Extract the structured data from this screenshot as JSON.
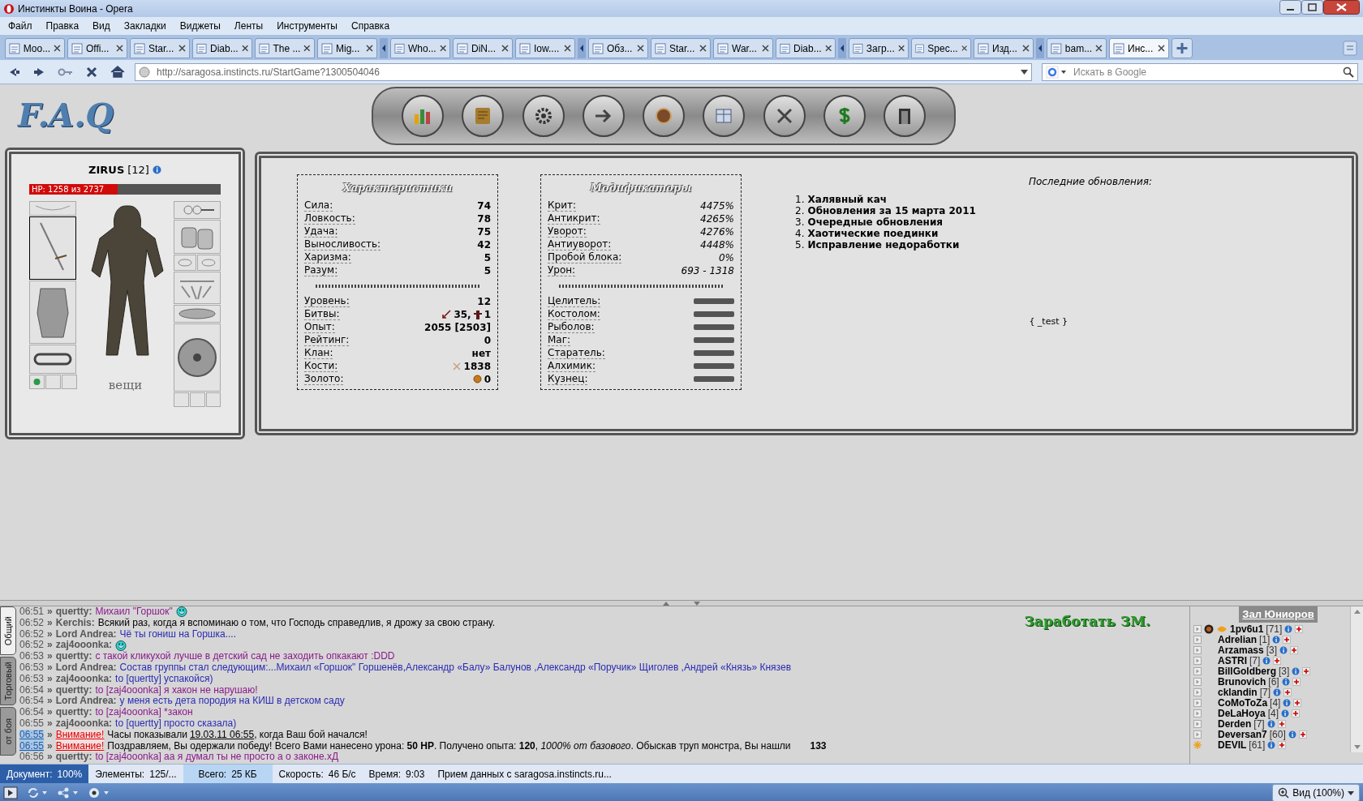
{
  "window": {
    "title": "Инстинкты Воина - Opera"
  },
  "menu": [
    "Файл",
    "Правка",
    "Вид",
    "Закладки",
    "Виджеты",
    "Ленты",
    "Инструменты",
    "Справка"
  ],
  "tabs": [
    {
      "kind": "tab",
      "label": "Moo...",
      "selected": false
    },
    {
      "kind": "tab",
      "label": "Offi...",
      "selected": false
    },
    {
      "kind": "tab",
      "label": "Star...",
      "selected": false
    },
    {
      "kind": "tab",
      "label": "Diab...",
      "selected": false
    },
    {
      "kind": "tab",
      "label": "The ...",
      "selected": false
    },
    {
      "kind": "tab",
      "label": "Mig...",
      "selected": false
    },
    {
      "kind": "stack"
    },
    {
      "kind": "tab",
      "label": "Who...",
      "selected": false
    },
    {
      "kind": "tab",
      "label": "DiN...",
      "selected": false
    },
    {
      "kind": "tab",
      "label": "Iow....",
      "selected": false
    },
    {
      "kind": "stack"
    },
    {
      "kind": "tab",
      "label": "Обз...",
      "selected": false
    },
    {
      "kind": "tab",
      "label": "Star...",
      "selected": false
    },
    {
      "kind": "tab",
      "label": "War...",
      "selected": false
    },
    {
      "kind": "tab",
      "label": "Diab...",
      "selected": false
    },
    {
      "kind": "stack"
    },
    {
      "kind": "tab",
      "label": "Загр...",
      "selected": false
    },
    {
      "kind": "tab",
      "label": "Spec...",
      "selected": false
    },
    {
      "kind": "tab",
      "label": "Изд...",
      "selected": false
    },
    {
      "kind": "stack"
    },
    {
      "kind": "tab",
      "label": "bam...",
      "selected": false
    },
    {
      "kind": "tab",
      "label": "Инс...",
      "selected": true
    }
  ],
  "address": {
    "url": "http://saragosa.instincts.ru/StartGame?1300504046"
  },
  "search": {
    "placeholder": "Искать в Google"
  },
  "logo": "F.A.Q",
  "character": {
    "name": "ZIRUS",
    "level": "[12]",
    "hp": {
      "text": "HP: 1258 из 2737",
      "level": 0.46
    },
    "items_label": "вещи"
  },
  "stats": {
    "title": "Характеристики",
    "rows": [
      {
        "label": "Сила:",
        "value": "74"
      },
      {
        "label": "Ловкость:",
        "value": "78"
      },
      {
        "label": "Удача:",
        "value": "75"
      },
      {
        "label": "Выносливость:",
        "value": "42"
      },
      {
        "label": "Харизма:",
        "value": "5"
      },
      {
        "label": "Разум:",
        "value": "5"
      }
    ],
    "rows2": [
      {
        "kind": "plain",
        "label": "Уровень:",
        "value": "12"
      },
      {
        "kind": "battles",
        "label": "Битвы:",
        "wins": "35,",
        "losses": "1"
      },
      {
        "kind": "plain",
        "label": "Опыт:",
        "value": "2055 [2503]"
      },
      {
        "kind": "plain",
        "label": "Рейтинг:",
        "value": "0"
      },
      {
        "kind": "plain",
        "label": "Клан:",
        "value": "нет"
      },
      {
        "kind": "bones",
        "label": "Кости:",
        "value": "1838"
      },
      {
        "kind": "gold",
        "label": "Золото:",
        "value": "0"
      }
    ]
  },
  "modifiers": {
    "title": "Модификаторы",
    "rows": [
      {
        "label": "Крит:",
        "value": "4475%"
      },
      {
        "label": "Антикрит:",
        "value": "4265%"
      },
      {
        "label": "Уворот:",
        "value": "4276%"
      },
      {
        "label": "Антиуворот:",
        "value": "4448%"
      },
      {
        "label": "Пробой блока:",
        "value": "0%"
      },
      {
        "label": "Урон:",
        "value": "693 - 1318"
      }
    ],
    "skills": [
      {
        "label": "Целитель:",
        "level": 0
      },
      {
        "label": "Костолом:",
        "level": 0
      },
      {
        "label": "Рыболов:",
        "level": 0
      },
      {
        "label": "Маг:",
        "level": 0
      },
      {
        "label": "Старатель:",
        "level": 0
      },
      {
        "label": "Алхимик:",
        "level": 0
      },
      {
        "label": "Кузнец:",
        "level": 0
      }
    ]
  },
  "updates": {
    "title": "Последние обновления:",
    "items": [
      {
        "number": "1.",
        "title": "Халявный кач"
      },
      {
        "number": "2.",
        "title": "Обновления за 15 марта 2011"
      },
      {
        "number": "3.",
        "title": "Очередные обновления"
      },
      {
        "number": "4.",
        "title": "Хаотические поединки"
      },
      {
        "number": "5.",
        "title": "Исправление недоработки"
      }
    ]
  },
  "test_label": "{ _test }",
  "chat": {
    "tabs": [
      {
        "label": "Общий",
        "selected": true
      },
      {
        "label": "Торговый",
        "selected": false
      },
      {
        "label": "от боя",
        "selected": false
      }
    ],
    "lines": [
      {
        "kind": "message",
        "time": "06:51",
        "marker": "»",
        "author": "quertty:",
        "text": "Михаил \"Горшок\"",
        "color": "#8b1a8b",
        "smiley": true
      },
      {
        "kind": "message",
        "time": "06:52",
        "marker": "»",
        "author": "Kerchis:",
        "text": "Всякий раз, когда я вспоминаю о том, что Господь справедлив, я дрожу за свою страну.",
        "color": "#000000"
      },
      {
        "kind": "message",
        "time": "06:52",
        "marker": "»",
        "author": "Lord Andrea:",
        "text": "Чё ты гониш на Горшка....",
        "color": "#2b2bb5"
      },
      {
        "kind": "message",
        "time": "06:52",
        "marker": "»",
        "author": "zaj4ooonka:",
        "smiley": true
      },
      {
        "kind": "message",
        "time": "06:53",
        "marker": "»",
        "author": "quertty:",
        "text": "с такой кликухой лучше в детский сад не заходить опкакают :DDD",
        "color": "#8b1a8b"
      },
      {
        "kind": "message",
        "time": "06:53",
        "marker": "»",
        "author": "Lord Andrea:",
        "text": "Состав группы стал следующим:...Михаил «Горшок\" Горшенёв,Александр «Балу» Балунов ,Александр «Поручик» Щиголев ,Андрей «Князь» Князев",
        "color": "#2b2bb5"
      },
      {
        "kind": "message",
        "time": "06:53",
        "marker": "»",
        "author": "zaj4ooonka:",
        "text": "to [quertty] успакойся)",
        "color": "#2b2bb5"
      },
      {
        "kind": "message",
        "time": "06:54",
        "marker": "»",
        "author": "quertty:",
        "text": "to [zaj4ooonka] я хакон не нарушаю!",
        "color": "#8b1a8b"
      },
      {
        "kind": "message",
        "time": "06:54",
        "marker": "»",
        "author": "Lord Andrea:",
        "text": "у меня есть дета породия на КИШ в детском саду",
        "color": "#2b2bb5"
      },
      {
        "kind": "message",
        "time": "06:54",
        "marker": "»",
        "author": "quertty:",
        "text": "to [zaj4ooonka] *закон",
        "color": "#8b1a8b"
      },
      {
        "kind": "message",
        "time": "06:55",
        "marker": "»",
        "author": "zaj4ooonka:",
        "text": "to [quertty] просто сказала)",
        "color": "#2b2bb5"
      },
      {
        "kind": "system",
        "time": "06:55",
        "marker": "»",
        "label": "Внимание!",
        "text": "Часы показывали",
        "link": "19.03.11 06:55",
        "text_after": ", когда Ваш бой начался!"
      },
      {
        "kind": "system",
        "time": "06:55",
        "marker": "»",
        "label": "Внимание!",
        "text": "Поздравляем, Вы одержали победу! Всего Вами нанесено урона: **50 HP**. Получено опыта: **120**, *1000% от базового*. Обыскав труп монстра, Вы нашли",
        "extra": "133"
      },
      {
        "kind": "message",
        "time": "06:56",
        "marker": "»",
        "author": "quertty:",
        "text": "to [zaj4ooonka] аа я думал ты не просто а о законе.хД",
        "color": "#8b1a8b"
      }
    ]
  },
  "earn_link": "Заработать ЗМ.",
  "users": {
    "title": "Зал Юниоров",
    "items": [
      {
        "name": "1pv6u1",
        "level": "[71]",
        "badges": true
      },
      {
        "name": "Adrelian",
        "level": "[1]"
      },
      {
        "name": "Arzamass",
        "level": "[3]"
      },
      {
        "name": "ASTRI",
        "level": "[7]"
      },
      {
        "name": "BillGoldberg",
        "level": "[3]"
      },
      {
        "name": "Brunovich",
        "level": "[6]"
      },
      {
        "name": "cklandin",
        "level": "[7]"
      },
      {
        "name": "CoMoToZa",
        "level": "[4]"
      },
      {
        "name": "DeLaHoya",
        "level": "[4]"
      },
      {
        "name": "Derden",
        "level": "[7]"
      },
      {
        "name": "Deversan7",
        "level": "[60]"
      },
      {
        "name": "DEVIL",
        "level": "[61]",
        "starred": true
      }
    ]
  },
  "status_bar": [
    {
      "kind": "progress",
      "label": "Документ:",
      "value": "100%"
    },
    {
      "kind": "plain",
      "label": "Элементы:",
      "value": "125/..."
    },
    {
      "kind": "light",
      "label": "Всего:",
      "value": "25 КБ"
    },
    {
      "kind": "plain",
      "label": "Скорость:",
      "value": "46 Б/с"
    },
    {
      "kind": "plain",
      "label": "Время:",
      "value": "9:03"
    },
    {
      "kind": "message",
      "label": "Прием данных с saragosa.instincts.ru..."
    }
  ],
  "zoom": "Вид (100%)"
}
